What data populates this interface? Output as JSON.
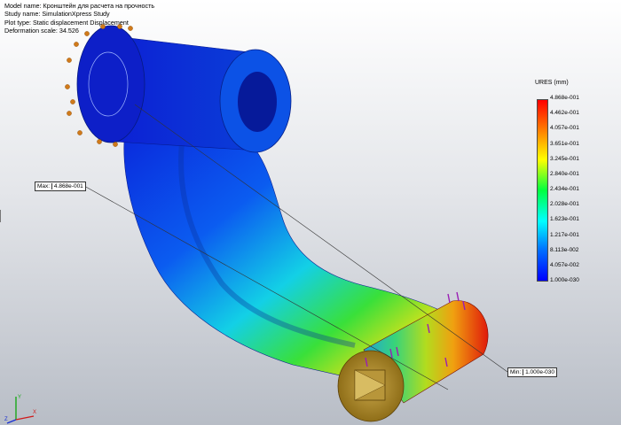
{
  "plot_info": {
    "model": "Model name: Кронштейн для расчета на прочность",
    "study": "Study name: SimulationXpress Study",
    "plot_type": "Plot type: Static displacement Displacement",
    "deformation_scale": "Deformation scale: 34.526"
  },
  "legend": {
    "title": "URES (mm)",
    "labels": [
      "4.868e-001",
      "4.462e-001",
      "4.057e-001",
      "3.651e-001",
      "3.245e-001",
      "2.840e-001",
      "2.434e-001",
      "2.028e-001",
      "1.623e-001",
      "1.217e-001",
      "8.113e-002",
      "4.057e-002",
      "1.000e-030"
    ],
    "colors": [
      "#ff0000",
      "#ff8000",
      "#ffff00",
      "#00ff40",
      "#00ffff",
      "#0070ff",
      "#0000ff"
    ]
  },
  "probes": {
    "max_label": "Max:",
    "max_value": "4.868e-001",
    "min_label": "Min:",
    "min_value": "1.000e-030"
  },
  "triad": {
    "x": "X",
    "y": "Y",
    "z": "Z"
  }
}
